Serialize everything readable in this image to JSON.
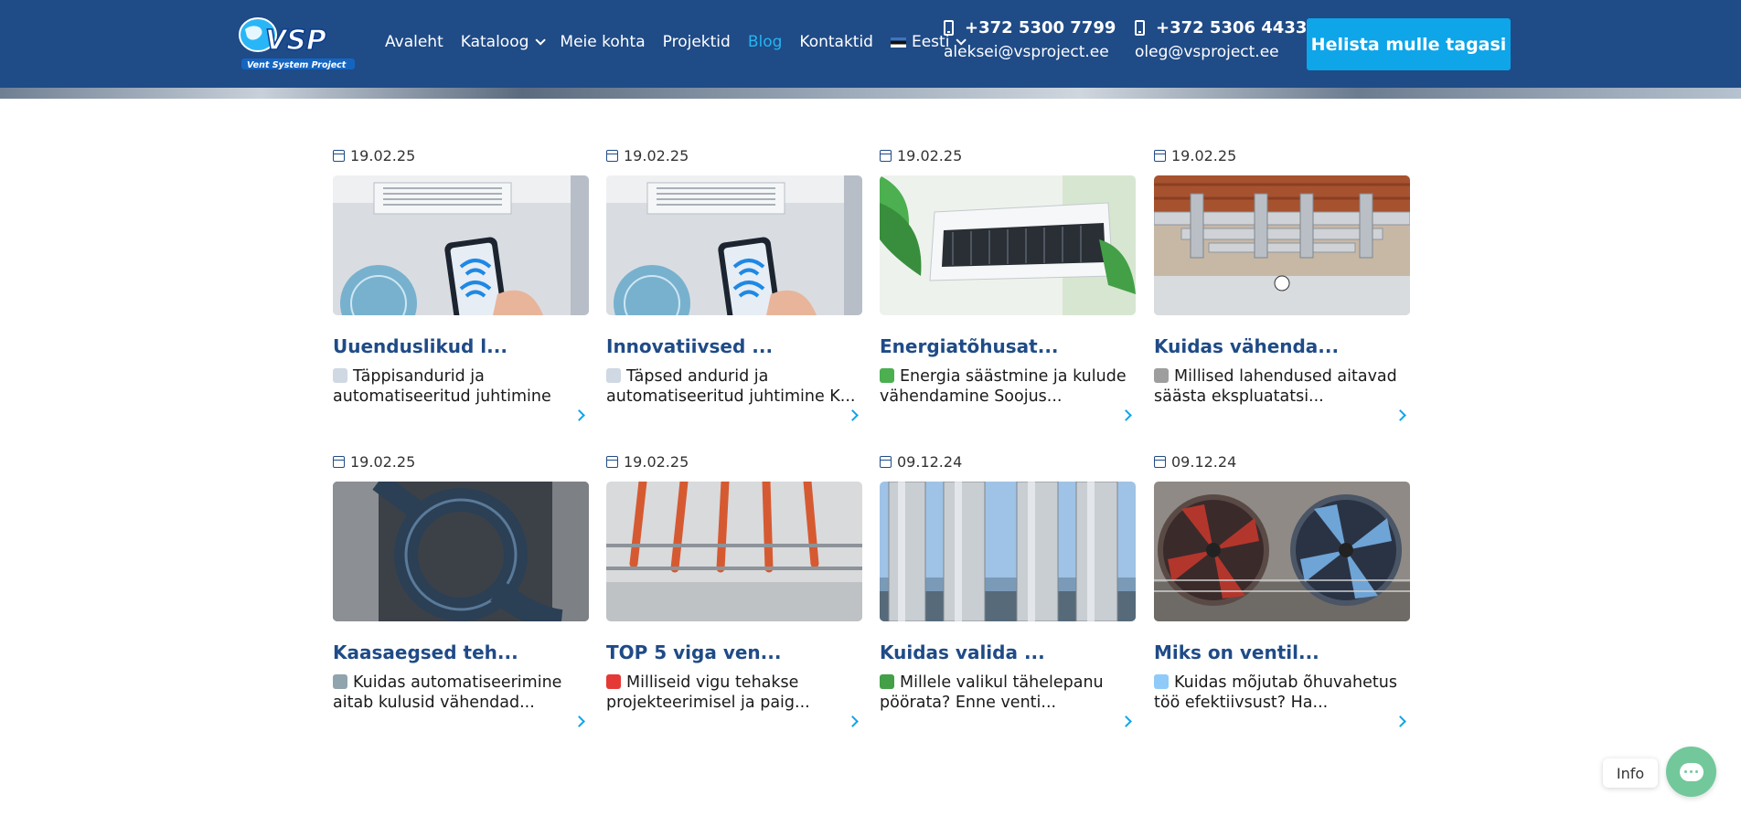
{
  "header": {
    "logo_alt": "VSP Vent System Project",
    "nav": [
      {
        "label": "Avaleht",
        "active": false,
        "dropdown": false
      },
      {
        "label": "Kataloog",
        "active": false,
        "dropdown": true
      },
      {
        "label": "Meie kohta",
        "active": false,
        "dropdown": false
      },
      {
        "label": "Projektid",
        "active": false,
        "dropdown": false
      },
      {
        "label": "Blog",
        "active": true,
        "dropdown": false
      },
      {
        "label": "Kontaktid",
        "active": false,
        "dropdown": false
      },
      {
        "label": "Eesti",
        "active": false,
        "dropdown": true,
        "flag": "estonia-flag"
      }
    ],
    "contacts": [
      {
        "phone": "+372 5300 7799",
        "email": "aleksei@vsproject.ee"
      },
      {
        "phone": "+372 5306 4433",
        "email": "oleg@vsproject.ee"
      }
    ],
    "cta_label": "Helista mulle tagasi"
  },
  "posts": [
    {
      "date": "19.02.25",
      "title": "Uuenduslikud l...",
      "emoji": "satellite-icon",
      "excerpt": "Täppisandurid ja automatiseeritud juhtimine Ka...",
      "image": "smart-ac-phone-wifi"
    },
    {
      "date": "19.02.25",
      "title": "Innovatiivsed ...",
      "emoji": "satellite-icon",
      "excerpt": "Täpsed andurid ja automatiseeritud juhtimine K...",
      "image": "smart-ac-phone-wifi"
    },
    {
      "date": "19.02.25",
      "title": "Energiatõhusat...",
      "emoji": "battery-icon",
      "excerpt": "Energia säästmine ja kulude vähendamine Soojus...",
      "image": "wall-ac-plant"
    },
    {
      "date": "19.02.25",
      "title": "Kuidas vähenda...",
      "emoji": "tools-icon",
      "excerpt": "Millised lahendused aitavad säästa ekspluatatsi...",
      "image": "industrial-ducts"
    },
    {
      "date": "19.02.25",
      "title": "Kaasaegsed teh...",
      "emoji": "robot-icon",
      "excerpt": "Kuidas automatiseerimine aitab kulusid vähendad...",
      "image": "spiral-duct"
    },
    {
      "date": "19.02.25",
      "title": "TOP 5 viga ven...",
      "emoji": "cross-mark-icon",
      "excerpt": "Milliseid vigu tehakse projekteerimisel ja paig...",
      "image": "red-pipes-ceiling"
    },
    {
      "date": "09.12.24",
      "title": "Kuidas valida ...",
      "emoji": "check-mark-icon",
      "excerpt": "Millele valikul tähelepanu pöörata? Enne venti...",
      "image": "steel-chimneys"
    },
    {
      "date": "09.12.24",
      "title": "Miks on ventil...",
      "emoji": "chart-icon",
      "excerpt": "Kuidas mõjutab õhuvahetus töö efektiivsust? Ha...",
      "image": "industrial-fans"
    }
  ],
  "chat": {
    "label": "Info"
  },
  "colors": {
    "header_bg": "#1f4b87",
    "accent": "#0ea5e9",
    "title": "#1f4b87",
    "chat": "#72c89a"
  }
}
